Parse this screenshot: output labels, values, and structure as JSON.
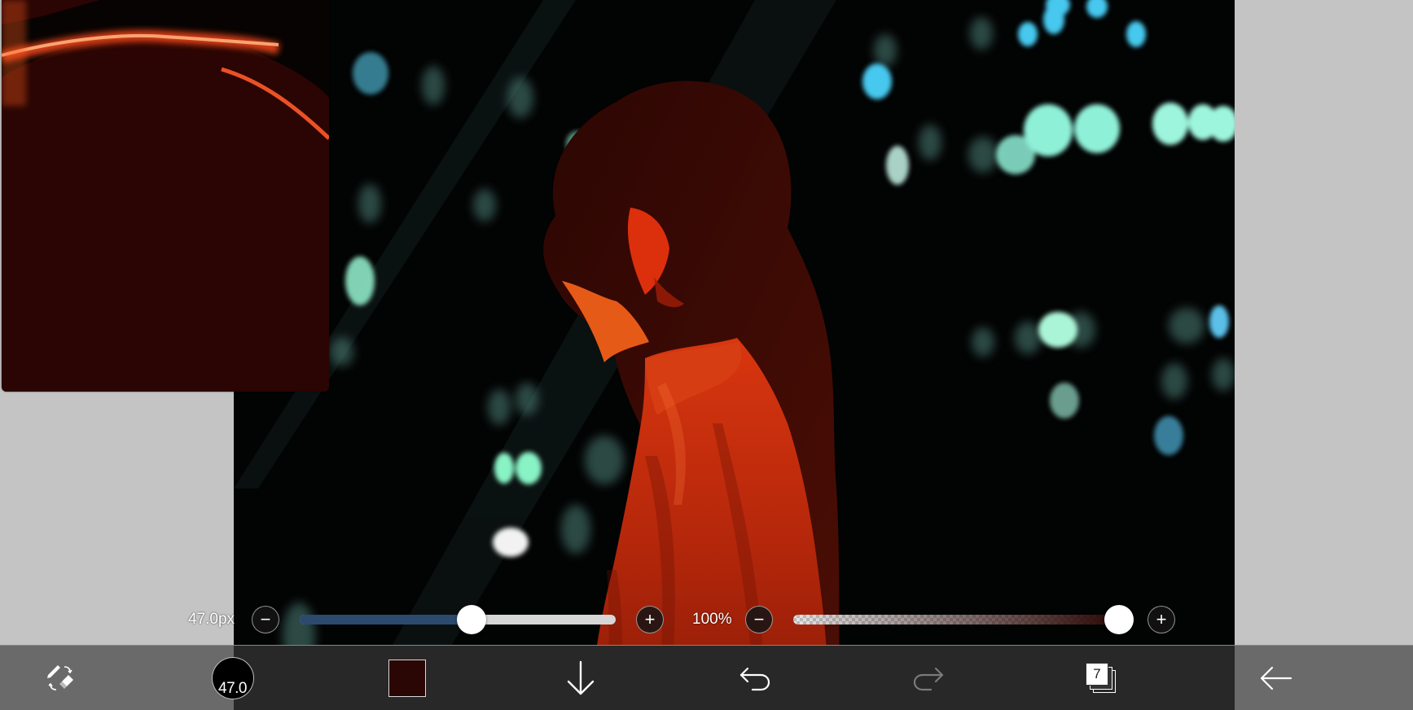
{
  "brush": {
    "size_label": "47.0px",
    "size_circle_label": "47.0",
    "size_fraction": 0.545
  },
  "opacity": {
    "label": "100%",
    "fraction": 1.0
  },
  "colors": {
    "current_color": "#2a0604",
    "size_fill": "#2b4a6e",
    "opacity_tint": "#2a0604",
    "hair": "#3b0a04",
    "shirt": "#c22b0c",
    "face_highlight": "#e23a10"
  },
  "layers": {
    "count": "7"
  },
  "buttons": {
    "minus": "−",
    "plus": "+"
  },
  "icons": {
    "pen_eraser": "pen-eraser-toggle-icon",
    "download": "arrow-down-icon",
    "undo": "undo-icon",
    "redo": "redo-icon",
    "layers": "layers-icon",
    "back": "arrow-left-icon"
  }
}
